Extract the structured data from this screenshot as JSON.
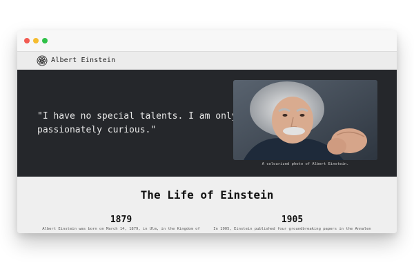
{
  "navbar": {
    "site_title": "Albert Einstein",
    "logo_icon": "atom-icon"
  },
  "hero": {
    "quote": "\"I have no special talents. I am only passionately curious.\"",
    "photo_caption": "A colourized photo of Albert Einstein."
  },
  "timeline": {
    "title": "The Life of Einstein",
    "entries": [
      {
        "year": "1879",
        "text": "Albert Einstein was born on March 14, 1879, in Ulm, in the Kingdom of"
      },
      {
        "year": "1905",
        "text": "In 1905, Einstein published four groundbreaking papers in the Annalen"
      }
    ]
  },
  "colors": {
    "hero_background": "#25272b",
    "section_background": "#efefef",
    "nav_background": "#ececec",
    "traffic_red": "#f25b52",
    "traffic_yellow": "#f5bc2f",
    "traffic_green": "#2fc148"
  }
}
